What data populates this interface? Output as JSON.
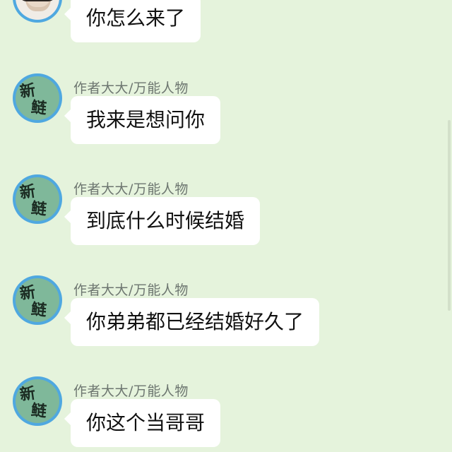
{
  "colors": {
    "background": "#e5f3dc",
    "bubble": "#ffffff",
    "avatar_ring": "#4fa8e0",
    "avatar_fill": "#7fb89a",
    "name_text": "#6d7670"
  },
  "messages": [
    {
      "sender": "",
      "avatar": "photo-avatar",
      "text": "你怎么来了"
    },
    {
      "sender": "作者大大/万能人物",
      "avatar": "xinlian-logo-avatar",
      "avatar_text": [
        "新",
        "鲢"
      ],
      "text": "我来是想问你"
    },
    {
      "sender": "作者大大/万能人物",
      "avatar": "xinlian-logo-avatar",
      "avatar_text": [
        "新",
        "鲢"
      ],
      "text": "到底什么时候结婚"
    },
    {
      "sender": "作者大大/万能人物",
      "avatar": "xinlian-logo-avatar",
      "avatar_text": [
        "新",
        "鲢"
      ],
      "text": "你弟弟都已经结婚好久了"
    },
    {
      "sender": "作者大大/万能人物",
      "avatar": "xinlian-logo-avatar",
      "avatar_text": [
        "新",
        "鲢"
      ],
      "text": "你这个当哥哥"
    }
  ]
}
